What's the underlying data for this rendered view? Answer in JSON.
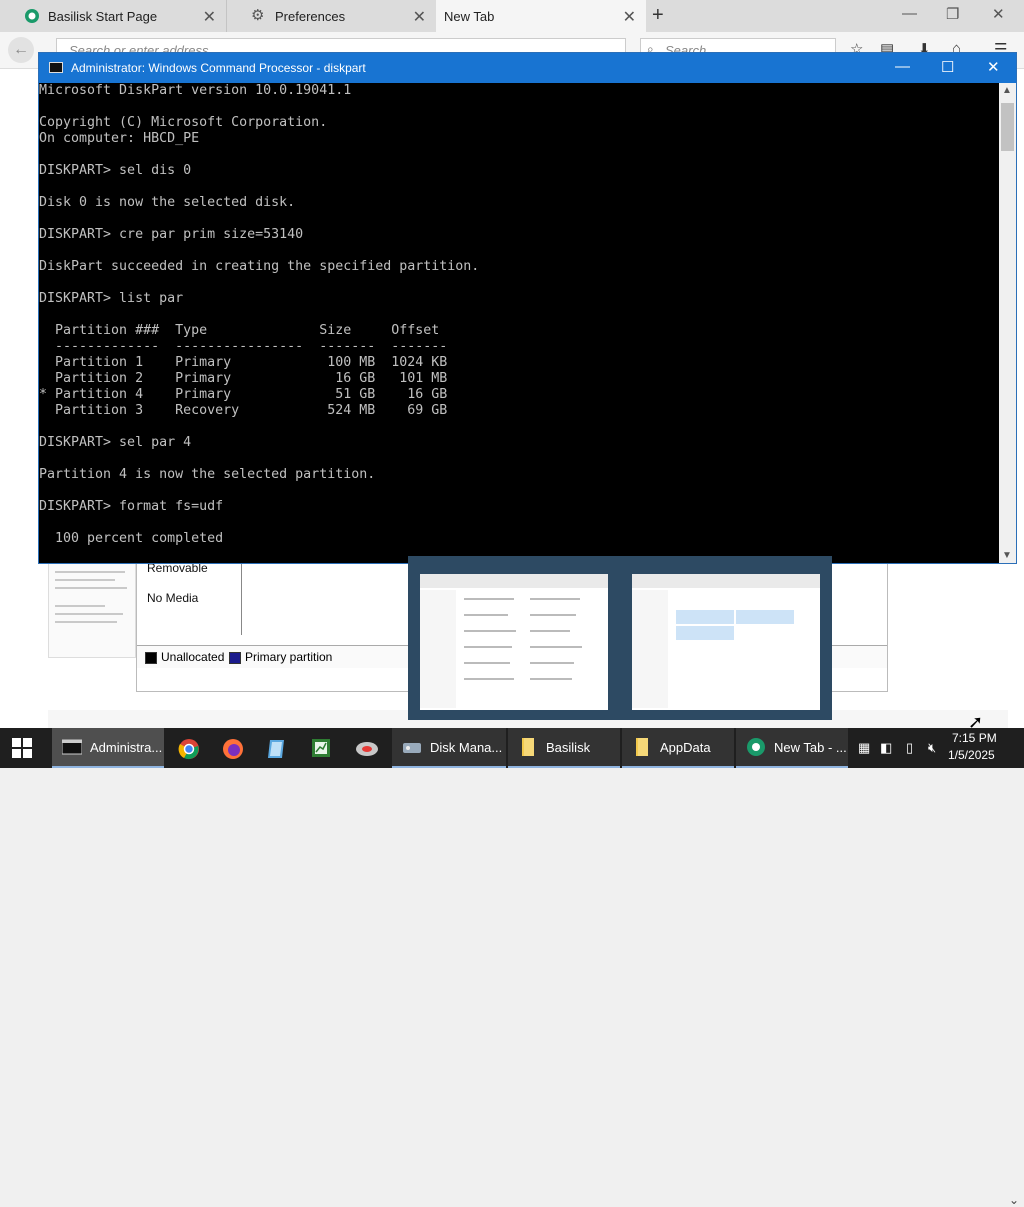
{
  "browser": {
    "tabs": [
      {
        "title": "Basilisk Start Page"
      },
      {
        "title": "Preferences"
      },
      {
        "title": "New Tab"
      }
    ],
    "url_placeholder": "Search or enter address",
    "search_placeholder": "Search"
  },
  "cmd": {
    "title": "Administrator: Windows Command Processor - diskpart",
    "output": "Microsoft DiskPart version 10.0.19041.1\n\nCopyright (C) Microsoft Corporation.\nOn computer: HBCD_PE\n\nDISKPART> sel dis 0\n\nDisk 0 is now the selected disk.\n\nDISKPART> cre par prim size=53140\n\nDiskPart succeeded in creating the specified partition.\n\nDISKPART> list par\n\n  Partition ###  Type              Size     Offset\n  -------------  ----------------  -------  -------\n  Partition 1    Primary            100 MB  1024 KB\n  Partition 2    Primary             16 GB   101 MB\n* Partition 4    Primary             51 GB    16 GB\n  Partition 3    Recovery           524 MB    69 GB\n\nDISKPART> sel par 4\n\nPartition 4 is now the selected partition.\n\nDISKPART> format fs=udf\n\n  100 percent completed"
  },
  "disk_management": {
    "removable": "Removable",
    "no_media": "No Media",
    "legend": [
      {
        "label": "Unallocated",
        "color": "#000000"
      },
      {
        "label": "Primary partition",
        "color": "#1a1a8c"
      }
    ]
  },
  "taskbar": {
    "items": [
      {
        "label": "Administra..."
      },
      {
        "label": "Disk Mana..."
      },
      {
        "label": "Basilisk"
      },
      {
        "label": "AppData"
      },
      {
        "label": "New Tab - ..."
      }
    ],
    "time": "7:15 PM",
    "date": "1/5/2025"
  },
  "colors": {
    "accent": "#1874d2",
    "console_text": "#c0c0c0",
    "taskbar": "#1f1f1f"
  }
}
